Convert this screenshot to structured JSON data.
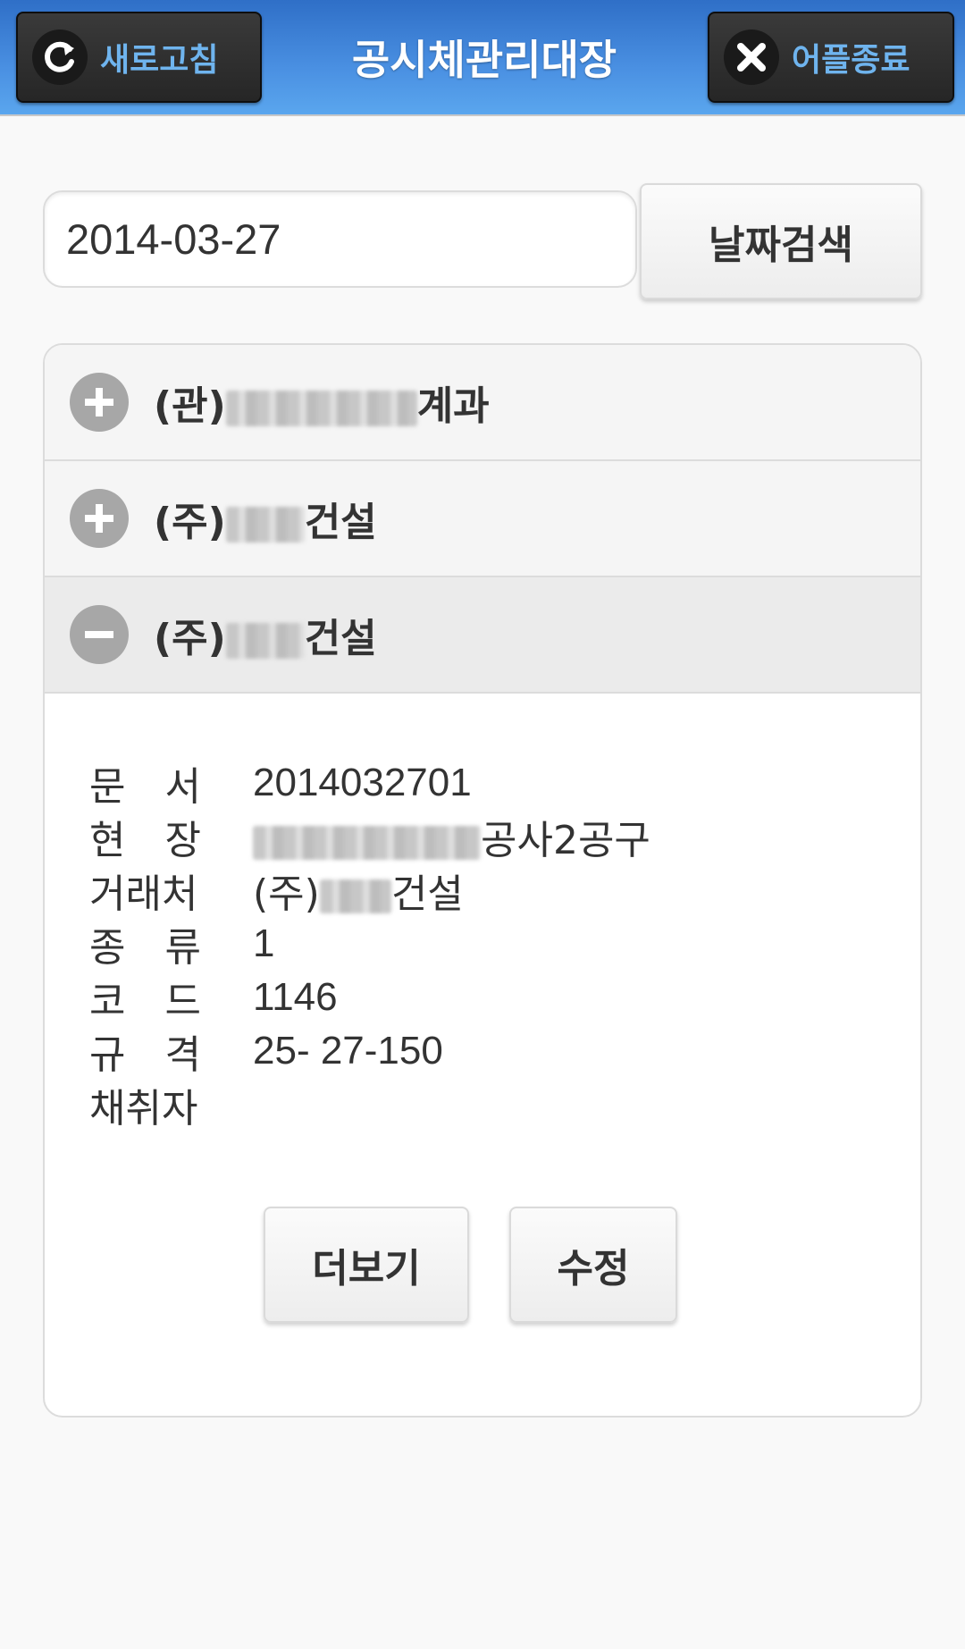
{
  "header": {
    "refresh_label": "새로고침",
    "title": "공시체관리대장",
    "exit_label": "어플종료"
  },
  "search": {
    "date_value": "2014-03-27",
    "button_label": "날짜검색"
  },
  "accordion": {
    "items": [
      {
        "prefix": "(관)",
        "suffix": "계과",
        "state": "collapsed"
      },
      {
        "prefix": "(주)",
        "suffix": "건설",
        "state": "collapsed"
      },
      {
        "prefix": "(주)",
        "suffix": "건설",
        "state": "expanded"
      }
    ]
  },
  "details": {
    "doc_label": "문　서",
    "doc_value": "2014032701",
    "site_label": "현　장",
    "site_suffix": "공사2공구",
    "client_label": "거래처",
    "client_prefix": "(주)",
    "client_suffix": "건설",
    "type_label": "종　류",
    "type_value": "1",
    "code_label": "코　드",
    "code_value": "1146",
    "spec_label": "규　격",
    "spec_value": "25- 27-150",
    "collector_label": "채취자",
    "collector_value": ""
  },
  "actions": {
    "more_label": "더보기",
    "edit_label": "수정"
  },
  "colors": {
    "header_blue": "#4a90e2",
    "header_button_text": "#6fb4ee",
    "accordion_icon": "#a7a7a7"
  },
  "icons": {
    "refresh": "refresh-icon",
    "exit": "close-icon",
    "expand": "plus-icon",
    "collapse": "minus-icon"
  }
}
